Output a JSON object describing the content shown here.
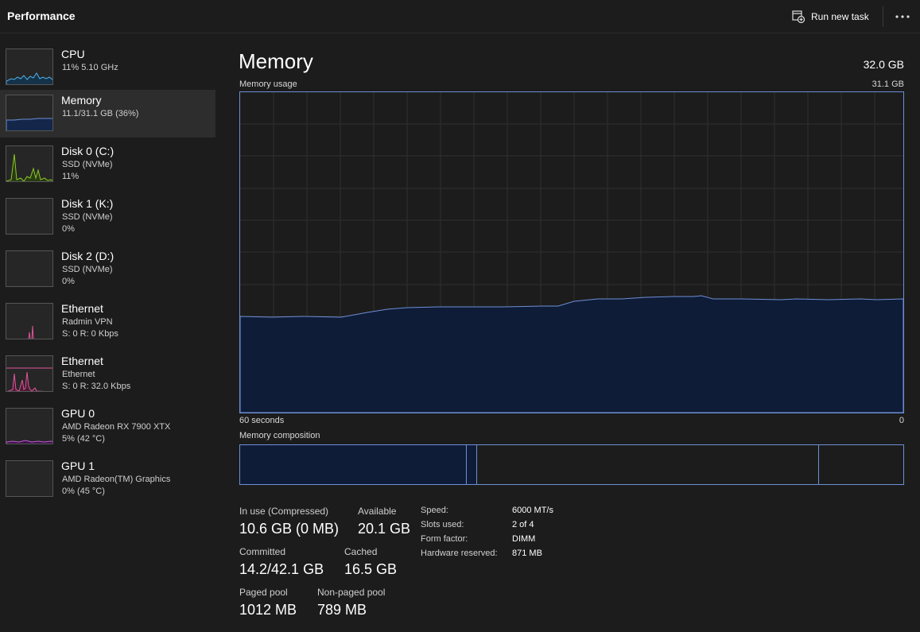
{
  "header": {
    "title": "Performance",
    "run_task_label": "Run new task",
    "run_task_icon": "run-task-icon",
    "more_icon": "more-icon"
  },
  "sidebar": {
    "items": [
      {
        "title": "CPU",
        "line1": "11%  5.10 GHz",
        "line2": "",
        "color": "#4fb3e8"
      },
      {
        "title": "Memory",
        "line1": "11.1/31.1 GB (36%)",
        "line2": "",
        "color": "#6d8fd4"
      },
      {
        "title": "Disk 0 (C:)",
        "line1": "SSD (NVMe)",
        "line2": "11%",
        "color": "#8ac926"
      },
      {
        "title": "Disk 1 (K:)",
        "line1": "SSD (NVMe)",
        "line2": "0%",
        "color": "#8ac926"
      },
      {
        "title": "Disk 2 (D:)",
        "line1": "SSD (NVMe)",
        "line2": "0%",
        "color": "#8ac926"
      },
      {
        "title": "Ethernet",
        "line1": "Radmin VPN",
        "line2": "S: 0  R: 0 Kbps",
        "color": "#e0559a"
      },
      {
        "title": "Ethernet",
        "line1": "Ethernet",
        "line2": "S: 0  R: 32.0 Kbps",
        "color": "#e0559a"
      },
      {
        "title": "GPU 0",
        "line1": "AMD Radeon RX 7900 XTX",
        "line2": "5%  (42 °C)",
        "color": "#c456d6"
      },
      {
        "title": "GPU 1",
        "line1": "AMD Radeon(TM) Graphics",
        "line2": "0%  (45 °C)",
        "color": "#c456d6"
      }
    ]
  },
  "main": {
    "title": "Memory",
    "total": "32.0 GB",
    "usage_label": "Memory usage",
    "usage_max": "31.1 GB",
    "x_left": "60 seconds",
    "x_right": "0",
    "composition_label": "Memory composition",
    "stats": {
      "in_use_label": "In use (Compressed)",
      "in_use_value": "10.6 GB (0 MB)",
      "available_label": "Available",
      "available_value": "20.1 GB",
      "committed_label": "Committed",
      "committed_value": "14.2/42.1 GB",
      "cached_label": "Cached",
      "cached_value": "16.5 GB",
      "paged_label": "Paged pool",
      "paged_value": "1012 MB",
      "nonpaged_label": "Non-paged pool",
      "nonpaged_value": "789 MB"
    },
    "specs": {
      "speed_label": "Speed:",
      "speed_value": "6000 MT/s",
      "slots_label": "Slots used:",
      "slots_value": "2 of 4",
      "form_label": "Form factor:",
      "form_value": "DIMM",
      "hwres_label": "Hardware reserved:",
      "hwres_value": "871 MB"
    }
  },
  "colors": {
    "accent": "#6d8fd4",
    "fill": "#0f1c38"
  }
}
